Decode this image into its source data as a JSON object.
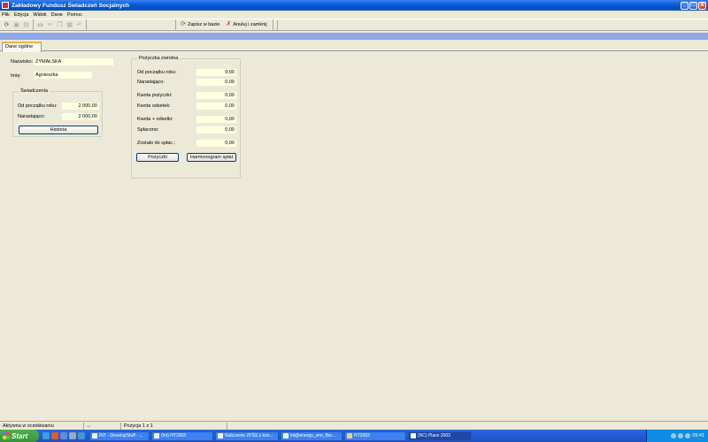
{
  "window": {
    "title": "Zakładowy Fundusz Świadczeń Socjalnych",
    "controls": [
      "_",
      "□",
      "X"
    ]
  },
  "menu": [
    "Plik",
    "Edycja",
    "Widok",
    "Dane",
    "Pomoc"
  ],
  "toolbar": {
    "save_label": "Zapisz w bazie",
    "cancel_close_label": "Anuluj i zamknij"
  },
  "tabs": [
    "Dane ogólne"
  ],
  "person": {
    "surname_label": "Nazwisko:",
    "surname_value": "ŻYMAŁSKA",
    "firstname_label": "Imię:",
    "firstname_value": "Agnieszka"
  },
  "benefits": {
    "title": "Świadczenia",
    "from_year_start_label": "Od początku roku:",
    "from_year_start_value": "2 000,00",
    "accrued_label": "Narastająco:",
    "accrued_value": "2 000,00",
    "history_button": "Historia"
  },
  "loan": {
    "title": "Pożyczka zwrotna",
    "from_year_start_label": "Od początku roku:",
    "from_year_start_value": "0,00",
    "accrued_label": "Narastająco:",
    "accrued_value": "0,00",
    "loan_amount_label": "Kwota pożyczki:",
    "loan_amount_value": "0,00",
    "interest_amount_label": "Kwota odsetek:",
    "interest_amount_value": "0,00",
    "amount_plus_interest_label": "Kwota + odsetki:",
    "amount_plus_interest_value": "0,00",
    "repaid_label": "Spłacono:",
    "repaid_value": "0,00",
    "remaining_label": "Zostało do spłac.:",
    "remaining_value": "0,00",
    "loans_button": "Pożyczki",
    "schedule_button": "Harmonogram spłat"
  },
  "status": {
    "state": "Aktywna w oczekiwaniu",
    "ellipsis": "...",
    "position": "Pozycja 1 z 1"
  },
  "taskbar": {
    "start_label": "Start",
    "tasks": [
      "INT - DevelopStuff - ...",
      "(Int) HT2003",
      "Naliczenie ZFŚS z kon...",
      "int@energo_srvr_fbo...",
      "HT2003",
      "(NC) Place 2003"
    ],
    "clock": "09:41"
  }
}
